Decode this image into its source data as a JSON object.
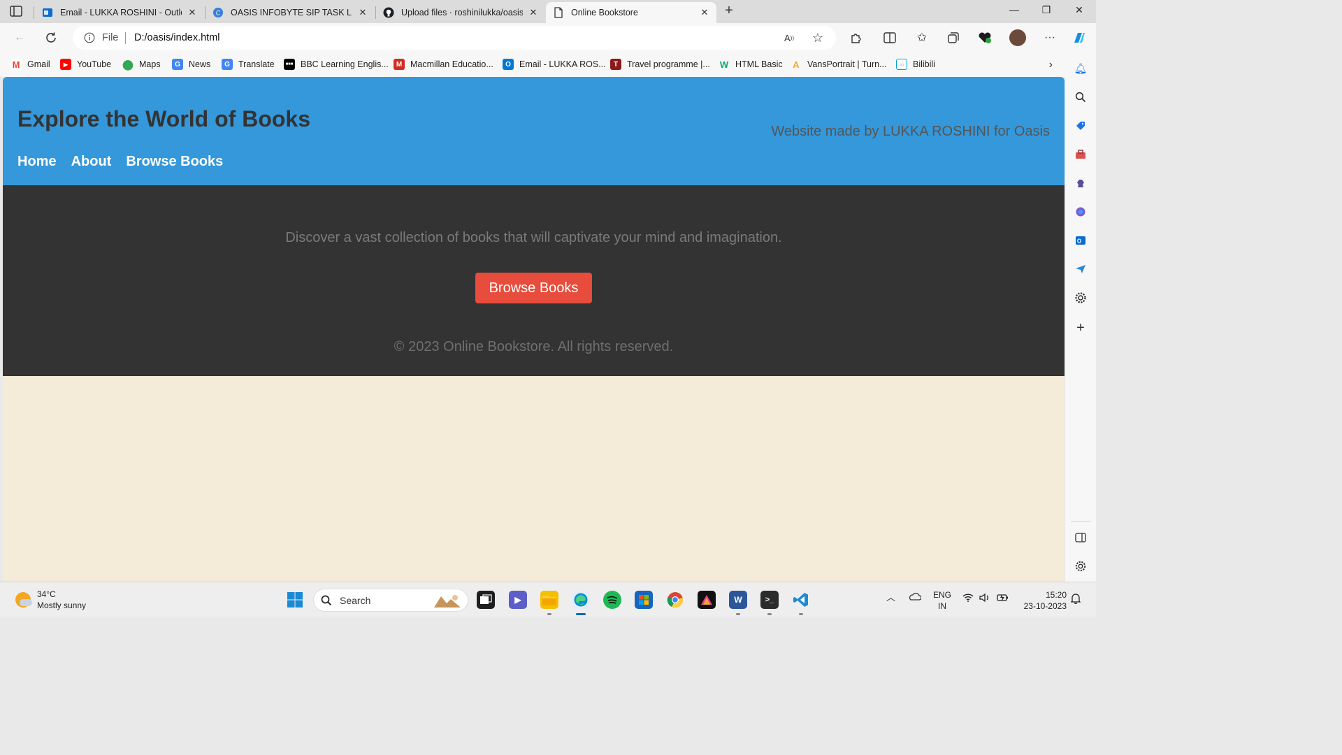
{
  "browser": {
    "tabs": [
      {
        "label": "Email - LUKKA ROSHINI - Outlook",
        "icon": "outlook-icon"
      },
      {
        "label": "OASIS INFOBYTE SIP TASK LIST",
        "icon": "canva-icon"
      },
      {
        "label": "Upload files · roshinilukka/oasis-i",
        "icon": "github-icon"
      },
      {
        "label": "Online Bookstore",
        "icon": "page-icon"
      }
    ],
    "address": {
      "scheme": "File",
      "url": "D:/oasis/index.html"
    },
    "favorites": [
      {
        "label": "Gmail",
        "icon": "gmail-icon",
        "color": "#ea4335"
      },
      {
        "label": "YouTube",
        "icon": "youtube-icon",
        "color": "#ff0000"
      },
      {
        "label": "Maps",
        "icon": "maps-icon",
        "color": "#34a853"
      },
      {
        "label": "News",
        "icon": "news-icon",
        "color": "#4285f4"
      },
      {
        "label": "Translate",
        "icon": "translate-icon",
        "color": "#4285f4"
      },
      {
        "label": "BBC Learning Englis...",
        "icon": "bbc-icon",
        "color": "#000000"
      },
      {
        "label": "Macmillan Educatio...",
        "icon": "macmillan-icon",
        "color": "#d52b1e"
      },
      {
        "label": "Email - LUKKA ROS...",
        "icon": "outlook-icon",
        "color": "#0078d4"
      },
      {
        "label": "Travel programme |...",
        "icon": "travel-icon",
        "color": "#8b1a1a"
      },
      {
        "label": "HTML Basic",
        "icon": "w3schools-icon",
        "color": "#04aa6d"
      },
      {
        "label": "VansPortrait | Turn...",
        "icon": "vansportrait-icon",
        "color": "#f5a623"
      },
      {
        "label": "Bilibili",
        "icon": "bilibili-icon",
        "color": "#00a1d6"
      }
    ]
  },
  "site": {
    "title": "Explore the World of Books",
    "credit": "Website made by LUKKA ROSHINI for Oasis",
    "nav": [
      "Home",
      "About",
      "Browse Books"
    ],
    "hero_text": "Discover a vast collection of books that will captivate your mind and imagination.",
    "cta": "Browse Books",
    "footer": "© 2023 Online Bookstore. All rights reserved."
  },
  "taskbar": {
    "weather": {
      "temp": "34°C",
      "condition": "Mostly sunny"
    },
    "search_placeholder": "Search",
    "lang": {
      "line1": "ENG",
      "line2": "IN"
    },
    "time": "15:20",
    "date": "23-10-2023"
  },
  "colors": {
    "header_bg": "#3498db",
    "hero_bg": "#333333",
    "cta_bg": "#e74c3c",
    "page_bg": "#f5ebd9"
  }
}
